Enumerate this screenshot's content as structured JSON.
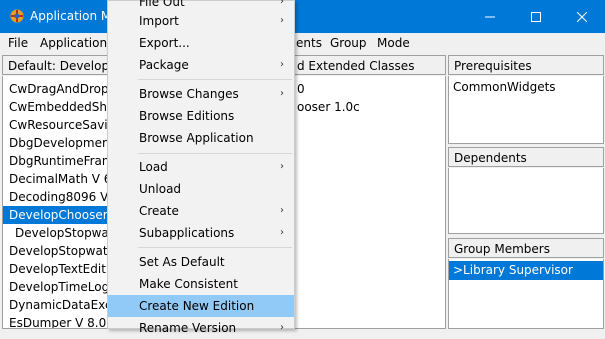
{
  "window": {
    "title": "Application M",
    "controls": {
      "minimize": "—",
      "maximize": "☐",
      "close": "✕"
    }
  },
  "menubar": {
    "file": "File",
    "applications": "Applications",
    "ents": "ents",
    "group": "Group",
    "mode": "Mode"
  },
  "left_pane": {
    "header": "Default: Develop",
    "items": [
      "CwDragAndDrop",
      "CwEmbeddedSh",
      "CwResourceSavi",
      "DbgDevelopmer",
      "DbgRuntimeFran",
      "DecimalMath V 6",
      "Decoding8096 V",
      "DevelopChooser",
      "DevelopStopwa",
      "DevelopStopwat",
      "DevelopTextEdit",
      "DevelopTimeLog",
      "DynamicDataExc",
      "EsDumper V 8.0"
    ],
    "selected_index": 7
  },
  "middle_pane": {
    "header": "d Extended Classes",
    "rows": [
      "0",
      "ooser 1.0c"
    ]
  },
  "prerequisites": {
    "header": "Prerequisites",
    "items": [
      "CommonWidgets"
    ]
  },
  "dependents": {
    "header": "Dependents",
    "items": []
  },
  "group_members": {
    "header": "Group Members",
    "items": [
      ">Library Supervisor"
    ]
  },
  "dropdown": {
    "items": [
      {
        "label": "File Out",
        "submenu": true
      },
      {
        "label": "Import",
        "submenu": true
      },
      {
        "label": "Export...",
        "submenu": false
      },
      {
        "label": "Package",
        "submenu": true
      },
      {
        "label": "Browse Changes",
        "submenu": true
      },
      {
        "label": "Browse Editions",
        "submenu": false
      },
      {
        "label": "Browse Application",
        "submenu": false
      },
      {
        "label": "Load",
        "submenu": true
      },
      {
        "label": "Unload",
        "submenu": false
      },
      {
        "label": "Create",
        "submenu": true
      },
      {
        "label": "Subapplications",
        "submenu": true
      },
      {
        "label": "Set As Default",
        "submenu": false
      },
      {
        "label": "Make Consistent",
        "submenu": false
      },
      {
        "label": "Create New Edition",
        "submenu": false
      },
      {
        "label": "Rename Version",
        "submenu": true
      }
    ],
    "highlighted_index": 13,
    "submenu_arrow": "›"
  },
  "colors": {
    "titlebar": "#0078d7",
    "selection": "#0078d7",
    "menu_highlight": "#91c9f7"
  }
}
